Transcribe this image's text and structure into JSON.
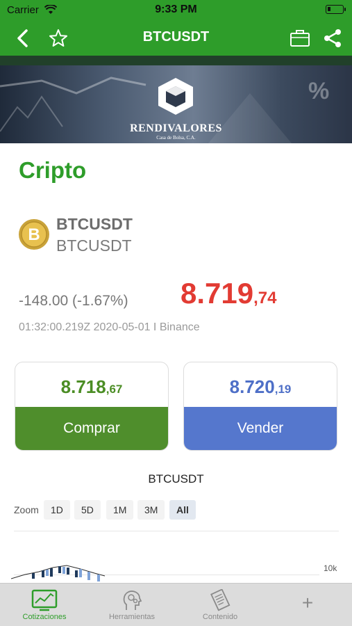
{
  "status_bar": {
    "carrier": "Carrier",
    "time": "9:33 PM"
  },
  "nav": {
    "title": "BTCUSDT"
  },
  "banner": {
    "brand": "RENDIVALORES",
    "subtitle": "Casa de Bolsa, C.A."
  },
  "section": {
    "title": "Cripto"
  },
  "instrument": {
    "symbol": "BTCUSDT",
    "name": "BTCUSDT",
    "change": "-148.00 (-1.67%)",
    "price_main": "8.719",
    "price_dec": ",74",
    "meta": "01:32:00.219Z 2020-05-01 I Binance"
  },
  "buy": {
    "price_main": "8.718",
    "price_dec": ",67",
    "label": "Comprar"
  },
  "sell": {
    "price_main": "8.720",
    "price_dec": ",19",
    "label": "Vender"
  },
  "chart": {
    "title": "BTCUSDT",
    "zoom_label": "Zoom",
    "zoom_options": [
      "1D",
      "5D",
      "1M",
      "3M",
      "All"
    ],
    "zoom_selected": "All",
    "y_axis_label": "10k"
  },
  "tabs": [
    {
      "label": "Cotizaciones",
      "icon": "chart-monitor-icon"
    },
    {
      "label": "Herramientas",
      "icon": "head-gears-icon"
    },
    {
      "label": "Contenido",
      "icon": "document-icon"
    },
    {
      "label": "+",
      "icon": "plus-icon"
    }
  ],
  "colors": {
    "brand_green": "#2e9d2a",
    "price_red": "#e23b33",
    "buy_green": "#4f8e2c",
    "sell_blue": "#5577cd"
  }
}
